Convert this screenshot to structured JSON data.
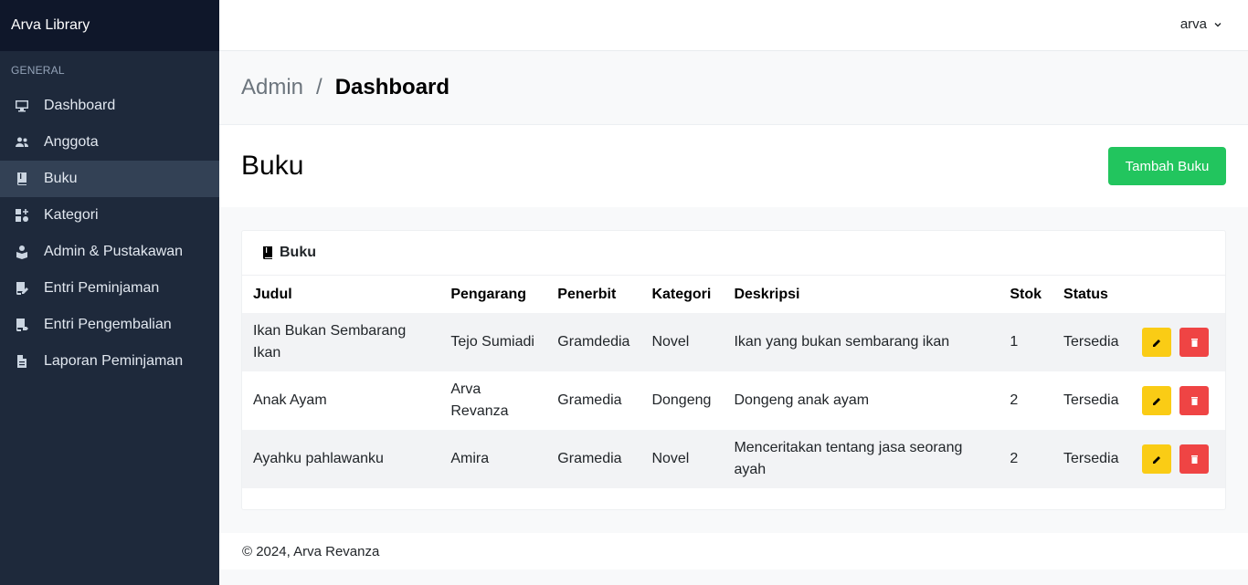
{
  "sidebar": {
    "brand": "Arva Library",
    "section": "GENERAL",
    "items": [
      {
        "label": "Dashboard",
        "icon": "monitor-icon"
      },
      {
        "label": "Anggota",
        "icon": "users-icon"
      },
      {
        "label": "Buku",
        "icon": "book-icon"
      },
      {
        "label": "Kategori",
        "icon": "category-icon"
      },
      {
        "label": "Admin & Pustakawan",
        "icon": "user-book-icon"
      },
      {
        "label": "Entri Peminjaman",
        "icon": "book-edit-icon"
      },
      {
        "label": "Entri Pengembalian",
        "icon": "book-return-icon"
      },
      {
        "label": "Laporan Peminjaman",
        "icon": "report-icon"
      }
    ],
    "active_index": 2
  },
  "topbar": {
    "user": "arva"
  },
  "breadcrumb": {
    "parent": "Admin",
    "separator": "/",
    "current": "Dashboard"
  },
  "page": {
    "title": "Buku",
    "add_button": "Tambah Buku"
  },
  "card": {
    "title": "Buku",
    "columns": [
      "Judul",
      "Pengarang",
      "Penerbit",
      "Kategori",
      "Deskripsi",
      "Stok",
      "Status"
    ],
    "rows": [
      {
        "judul": "Ikan Bukan Sembarang Ikan",
        "pengarang": "Tejo Sumiadi",
        "penerbit": "Gramdedia",
        "kategori": "Novel",
        "deskripsi": "Ikan yang bukan sembarang ikan",
        "stok": "1",
        "status": "Tersedia"
      },
      {
        "judul": "Anak Ayam",
        "pengarang": "Arva Revanza",
        "penerbit": "Gramedia",
        "kategori": "Dongeng",
        "deskripsi": "Dongeng anak ayam",
        "stok": "2",
        "status": "Tersedia"
      },
      {
        "judul": "Ayahku pahlawanku",
        "pengarang": "Amira",
        "penerbit": "Gramedia",
        "kategori": "Novel",
        "deskripsi": "Menceritakan tentang jasa seorang ayah",
        "stok": "2",
        "status": "Tersedia"
      }
    ]
  },
  "footer": {
    "text": "© 2024, Arva Revanza"
  },
  "colors": {
    "sidebar": "#1e293b",
    "brand_bar": "#0f172a",
    "active": "#334155",
    "success": "#22c55e",
    "warning": "#facc15",
    "danger": "#ef4444"
  }
}
